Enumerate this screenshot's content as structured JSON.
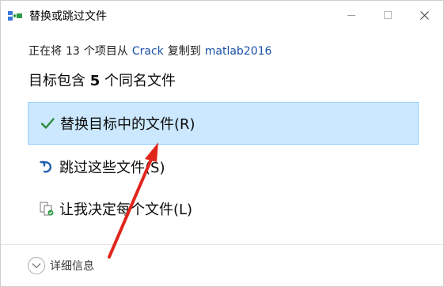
{
  "window": {
    "title": "替换或跳过文件",
    "controls": {
      "minimize_icon": "minimize-icon",
      "maximize_icon": "maximize-icon",
      "close_icon": "close-icon"
    }
  },
  "status": {
    "prefix": "正在将",
    "count": "13",
    "middle": "个项目从",
    "source": "Crack",
    "action": "复制到",
    "destination": "matlab2016"
  },
  "heading": {
    "prefix": "目标包含",
    "count": "5",
    "suffix": "个同名文件"
  },
  "options": [
    {
      "label": "替换目标中的文件(R)",
      "icon": "checkmark-icon",
      "selected": true
    },
    {
      "label": "跳过这些文件(S)",
      "icon": "skip-icon",
      "selected": false
    },
    {
      "label": "让我决定每个文件(L)",
      "icon": "compare-files-icon",
      "selected": false
    }
  ],
  "footer": {
    "details_label": "详细信息",
    "details_icon": "chevron-down-icon"
  },
  "colors": {
    "selected_bg": "#cce8ff",
    "selected_border": "#99d1ff",
    "link": "#1a50a4",
    "check": "#2b8a3e",
    "skip": "#1f5fb0",
    "annotation": "#e0261c"
  }
}
